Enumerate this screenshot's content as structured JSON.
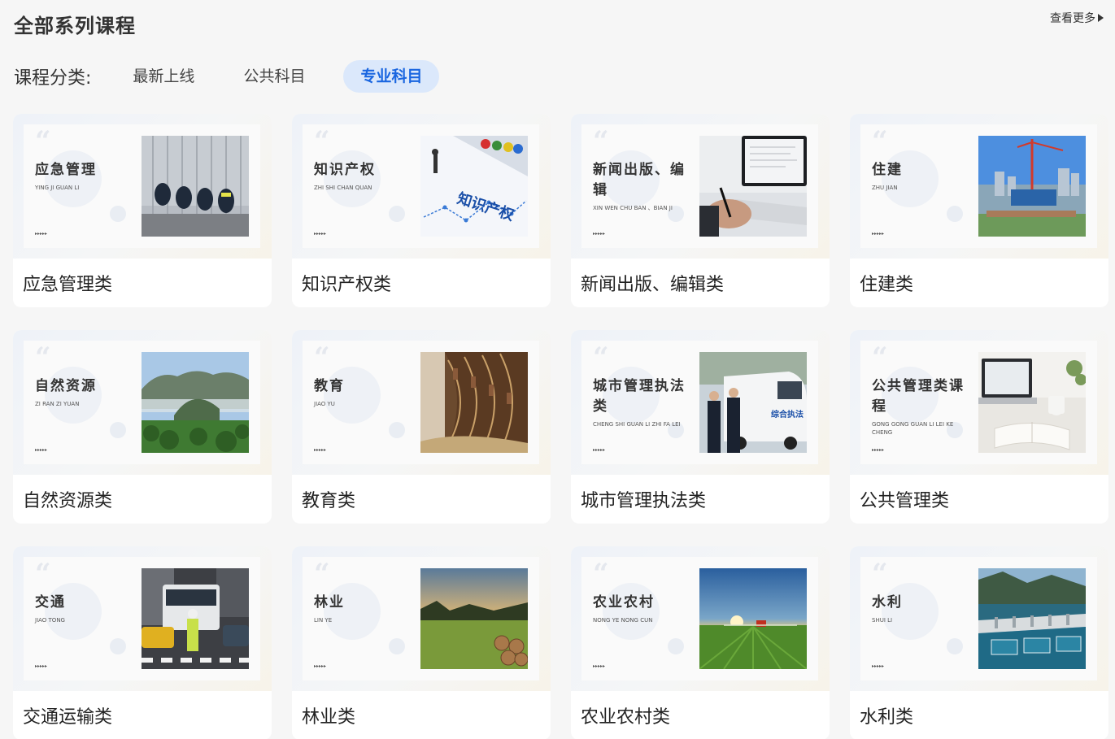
{
  "header": {
    "title": "全部系列课程",
    "view_more": "查看更多"
  },
  "filter": {
    "label": "课程分类:",
    "tabs": [
      {
        "label": "最新上线",
        "active": false
      },
      {
        "label": "公共科目",
        "active": false
      },
      {
        "label": "专业科目",
        "active": true
      }
    ]
  },
  "courses": [
    {
      "title": "应急管理类",
      "thumb_cn": "应急管理",
      "thumb_py": "YING JI GUAN LI",
      "dots": "▸▸▸▸▸",
      "photo": "emergency-workers-photo"
    },
    {
      "title": "知识产权类",
      "thumb_cn": "知识产权",
      "thumb_py": "ZHI SHI CHAN QUAN",
      "dots": "▸▸▸▸▸",
      "photo": "intellectual-property-photo",
      "photo_text": "知识产权"
    },
    {
      "title": "新闻出版、编辑类",
      "thumb_cn": "新闻出版、编辑",
      "thumb_py": "XIN WEN CHU BAN 、BIAN JI",
      "dots": "▸▸▸▸▸",
      "photo": "writing-desk-photo"
    },
    {
      "title": "住建类",
      "thumb_cn": "住建",
      "thumb_py": "ZHU JIAN",
      "dots": "▸▸▸▸▸",
      "photo": "construction-site-photo"
    },
    {
      "title": "自然资源类",
      "thumb_cn": "自然资源",
      "thumb_py": "ZI RAN ZI YUAN",
      "dots": "▸▸▸▸▸",
      "photo": "mountain-landscape-photo"
    },
    {
      "title": "教育类",
      "thumb_cn": "教育",
      "thumb_py": "JIAO YU",
      "dots": "▸▸▸▸▸",
      "photo": "library-bookshelf-photo"
    },
    {
      "title": "城市管理执法类",
      "thumb_cn": "城市管理执法类",
      "thumb_py": "CHENG SHI GUAN LI ZHI FA LEI",
      "dots": "▸▸▸▸▸",
      "photo": "city-enforcement-photo",
      "photo_text": "综合执法"
    },
    {
      "title": "公共管理类",
      "thumb_cn": "公共管理类课程",
      "thumb_py": "GONG GONG GUAN LI LEI KE CHENG",
      "dots": "▸▸▸▸▸",
      "photo": "laptop-desk-photo"
    },
    {
      "title": "交通运输类",
      "thumb_cn": "交通",
      "thumb_py": "JIAO TONG",
      "dots": "▸▸▸▸▸",
      "photo": "traffic-police-photo"
    },
    {
      "title": "林业类",
      "thumb_cn": "林业",
      "thumb_py": "LIN YE",
      "dots": "▸▸▸▸▸",
      "photo": "forest-sunset-photo"
    },
    {
      "title": "农业农村类",
      "thumb_cn": "农业农村",
      "thumb_py": "NONG YE NONG CUN",
      "dots": "▸▸▸▸▸",
      "photo": "farm-field-photo"
    },
    {
      "title": "水利类",
      "thumb_cn": "水利",
      "thumb_py": "SHUI LI",
      "dots": "▸▸▸▸▸",
      "photo": "water-dam-photo"
    }
  ]
}
